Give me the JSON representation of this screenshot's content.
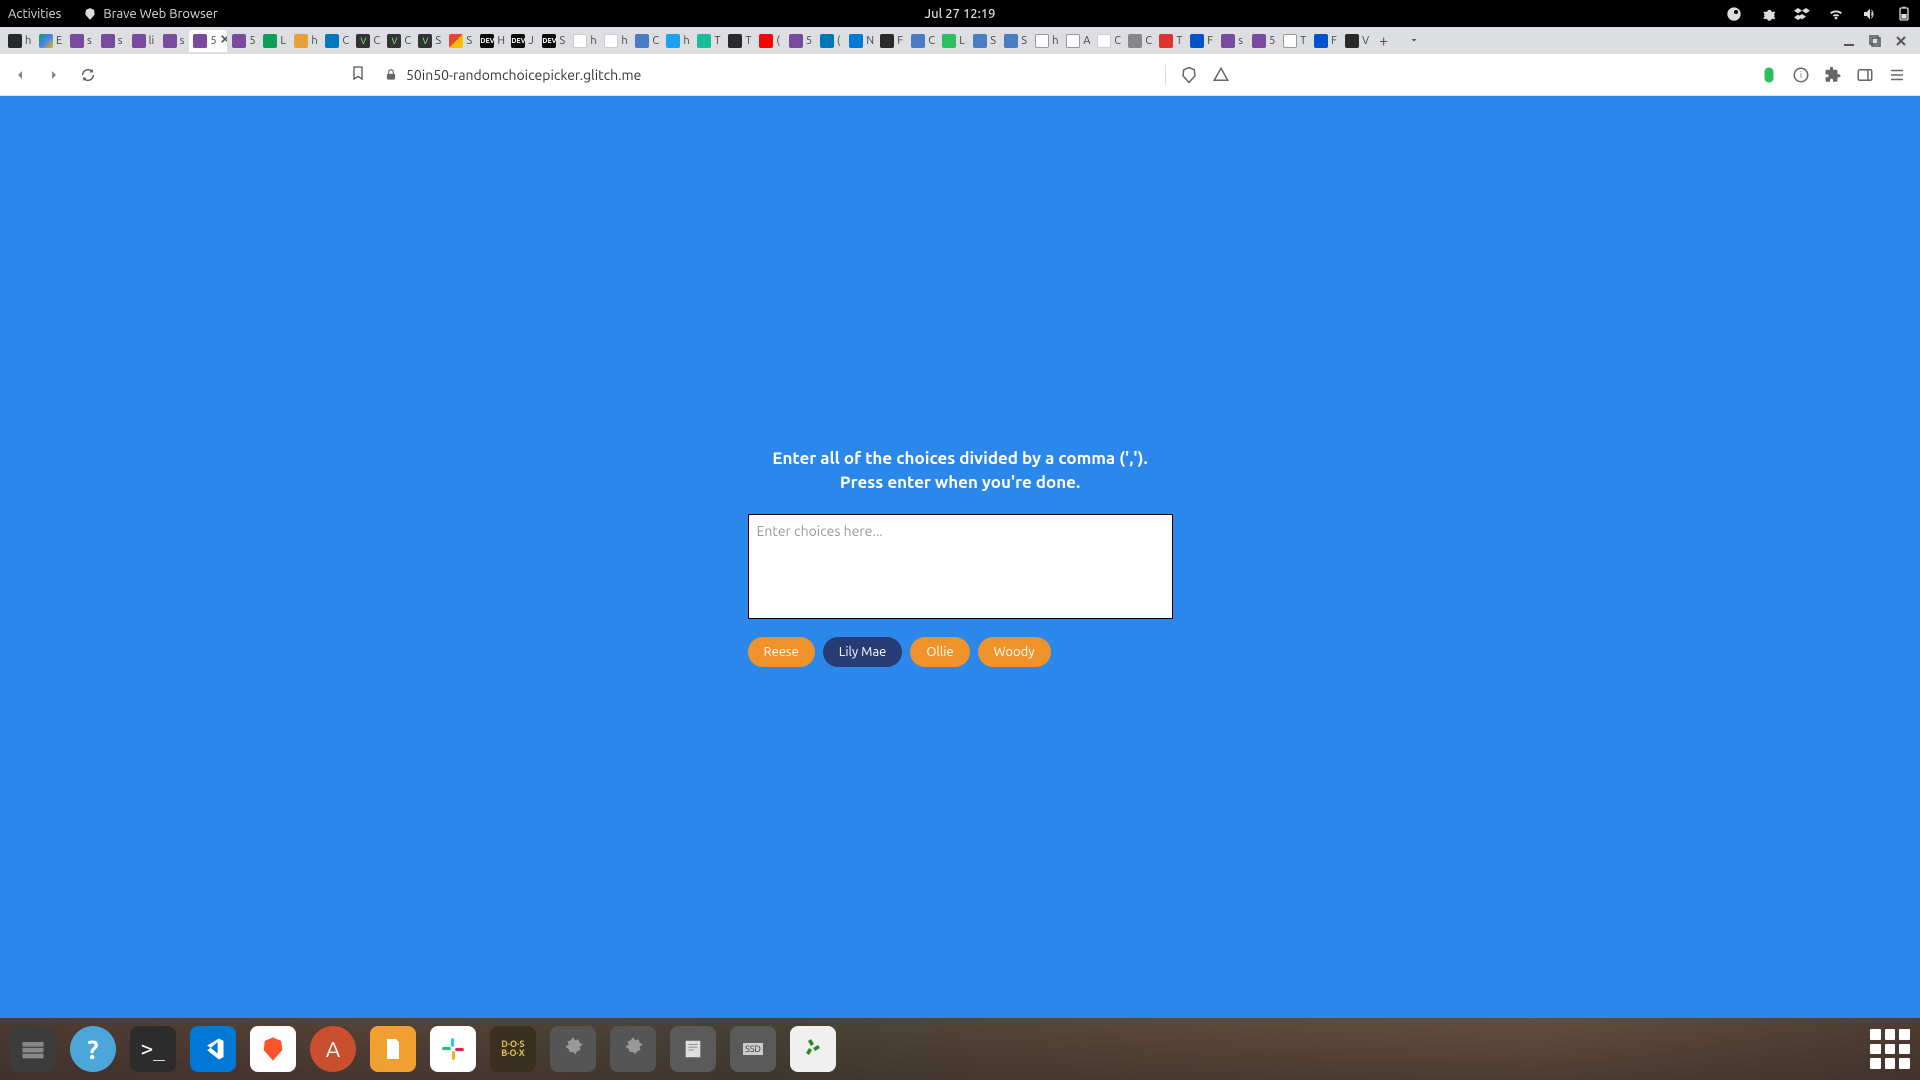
{
  "gnome": {
    "activities": "Activities",
    "browser": "Brave Web Browser",
    "datetime": "Jul 27  12:19"
  },
  "tabs": [
    {
      "label": "h",
      "fav": "fav-github"
    },
    {
      "label": "E",
      "fav": "fav-drive"
    },
    {
      "label": "s",
      "fav": "fav-purple"
    },
    {
      "label": "s",
      "fav": "fav-purple"
    },
    {
      "label": "li",
      "fav": "fav-purple"
    },
    {
      "label": "s",
      "fav": "fav-purple"
    },
    {
      "label": "5",
      "fav": "fav-purple",
      "active": true
    },
    {
      "label": "5",
      "fav": "fav-purple"
    },
    {
      "label": "L",
      "fav": "fav-sheets"
    },
    {
      "label": "h",
      "fav": "fav-orange"
    },
    {
      "label": "C",
      "fav": "fav-trello"
    },
    {
      "label": "C",
      "fav": "fav-v"
    },
    {
      "label": "C",
      "fav": "fav-v"
    },
    {
      "label": "S",
      "fav": "fav-v"
    },
    {
      "label": "S",
      "fav": "fav-gmail"
    },
    {
      "label": "H",
      "fav": "fav-dev"
    },
    {
      "label": "J",
      "fav": "fav-dev"
    },
    {
      "label": "S",
      "fav": "fav-dev"
    },
    {
      "label": "h",
      "fav": "fav-white"
    },
    {
      "label": "h",
      "fav": "fav-white"
    },
    {
      "label": "C",
      "fav": "fav-blue"
    },
    {
      "label": "h",
      "fav": "fav-twitter"
    },
    {
      "label": "T",
      "fav": "fav-teal"
    },
    {
      "label": "T",
      "fav": "fav-dark"
    },
    {
      "label": "(",
      "fav": "fav-yt"
    },
    {
      "label": "5",
      "fav": "fav-purple"
    },
    {
      "label": "(",
      "fav": "fav-linkedin"
    },
    {
      "label": "N",
      "fav": "fav-outlook"
    },
    {
      "label": "F",
      "fav": "fav-dark"
    },
    {
      "label": "C",
      "fav": "fav-blue"
    },
    {
      "label": "L",
      "fav": "fav-evernote"
    },
    {
      "label": "S",
      "fav": "fav-blue"
    },
    {
      "label": "S",
      "fav": "fav-blue"
    },
    {
      "label": "h",
      "fav": "fav-wiki"
    },
    {
      "label": "A",
      "fav": "fav-wiki"
    },
    {
      "label": "C",
      "fav": "fav-white"
    },
    {
      "label": "C",
      "fav": "fav-gray"
    },
    {
      "label": "T",
      "fav": "fav-red"
    },
    {
      "label": "F",
      "fav": "fav-jira"
    },
    {
      "label": "s",
      "fav": "fav-purple"
    },
    {
      "label": "5",
      "fav": "fav-purple"
    },
    {
      "label": "T",
      "fav": "fav-wiki"
    },
    {
      "label": "F",
      "fav": "fav-jira"
    },
    {
      "label": "V",
      "fav": "fav-dark"
    }
  ],
  "url": "50in50-randomchoicepicker.glitch.me",
  "content": {
    "heading_line1": "Enter all of the choices divided by a comma (',').",
    "heading_line2": "Press enter when you're done.",
    "placeholder": "Enter choices here...",
    "tags": [
      {
        "label": "Reese",
        "highlight": false
      },
      {
        "label": "Lily Mae",
        "highlight": true
      },
      {
        "label": "Ollie",
        "highlight": false
      },
      {
        "label": "Woody",
        "highlight": false
      }
    ]
  }
}
